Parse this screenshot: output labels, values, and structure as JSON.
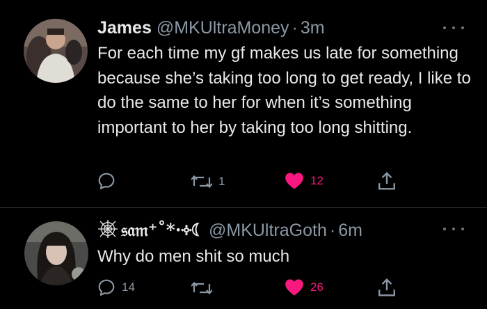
{
  "tweets": [
    {
      "name": "James",
      "handle": "@MKUltraMoney",
      "separator": "·",
      "time": "3m",
      "text": "For each time my gf makes us late for something because she’s taking too long to get ready, I like to do the same to her for when it’s something important to her by taking too long shitting.",
      "replies": "",
      "retweets": "1",
      "likes": "12",
      "liked": true
    },
    {
      "name_prefix_icon": "spiderweb-icon",
      "name": "𝔰𝔞𝔪⁺˚*·༓☾",
      "handle": "@MKUltraGoth",
      "separator": "·",
      "time": "6m",
      "text": "Why do men shit so much",
      "replies": "14",
      "retweets": "",
      "likes": "26",
      "liked": true
    }
  ],
  "colors": {
    "background": "#000000",
    "text": "#e7e9ea",
    "secondary": "#8b98a5",
    "like": "#f91880",
    "divider": "#2f3336"
  }
}
